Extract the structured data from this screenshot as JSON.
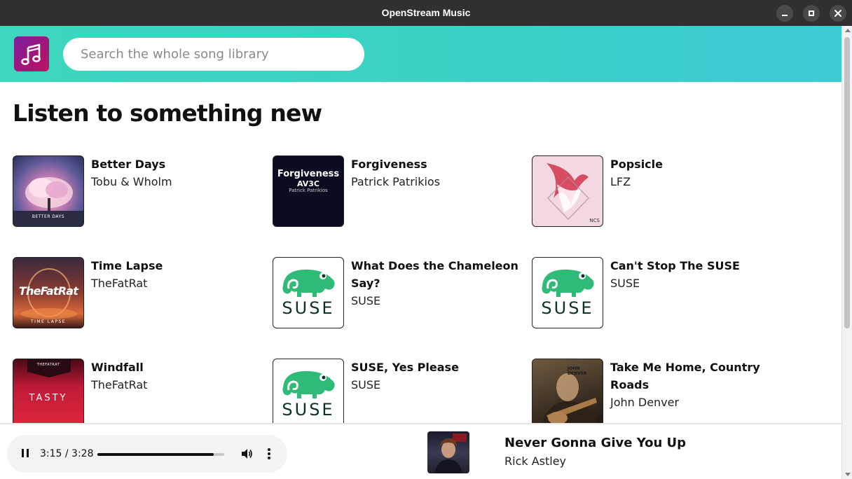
{
  "window": {
    "title": "OpenStream Music"
  },
  "header": {
    "search_placeholder": "Search the whole song library"
  },
  "main": {
    "heading": "Listen to something new",
    "songs": [
      {
        "title": "Better Days",
        "artist": "Tobu & Wholm",
        "cover_text": "BETTER DAYS"
      },
      {
        "title": "Forgiveness",
        "artist": "Patrick Patrikios",
        "cover_text": "Forgiveness",
        "cover_sub": "AV3C",
        "cover_sub2": "Patrick Patrikios"
      },
      {
        "title": "Popsicle",
        "artist": "LFZ",
        "cover_text": "NCS"
      },
      {
        "title": "Time Lapse",
        "artist": "TheFatRat",
        "cover_text": "TheFatRat",
        "cover_sub": "TIME LAPSE"
      },
      {
        "title": "What Does the Chameleon Say?",
        "artist": "SUSE",
        "cover_text": "SUSE"
      },
      {
        "title": "Can't Stop The SUSE",
        "artist": "SUSE",
        "cover_text": "SUSE"
      },
      {
        "title": "Windfall",
        "artist": "TheFatRat",
        "cover_text": "TASTY",
        "cover_sub": "THEFATRAT"
      },
      {
        "title": "SUSE, Yes Please",
        "artist": "SUSE",
        "cover_text": "SUSE"
      },
      {
        "title": "Take Me Home, Country Roads",
        "artist": "John Denver",
        "cover_text": "JOHN DENVER"
      }
    ]
  },
  "player": {
    "time": "3:15 / 3:28",
    "progress": 0.9184,
    "now_playing": {
      "title": "Never Gonna Give You Up",
      "artist": "Rick Astley"
    }
  },
  "icons": {
    "logo": "music-note-icon",
    "pause": "pause-icon",
    "volume": "volume-icon",
    "more": "more-vertical-icon",
    "suse": "suse-chameleon-icon"
  },
  "colors": {
    "header_gradient_start": "#3fd6be",
    "header_gradient_end": "#3ecbd6",
    "suse_green": "#30ba78",
    "logo_start": "#7a1fa0",
    "logo_end": "#c21262"
  }
}
